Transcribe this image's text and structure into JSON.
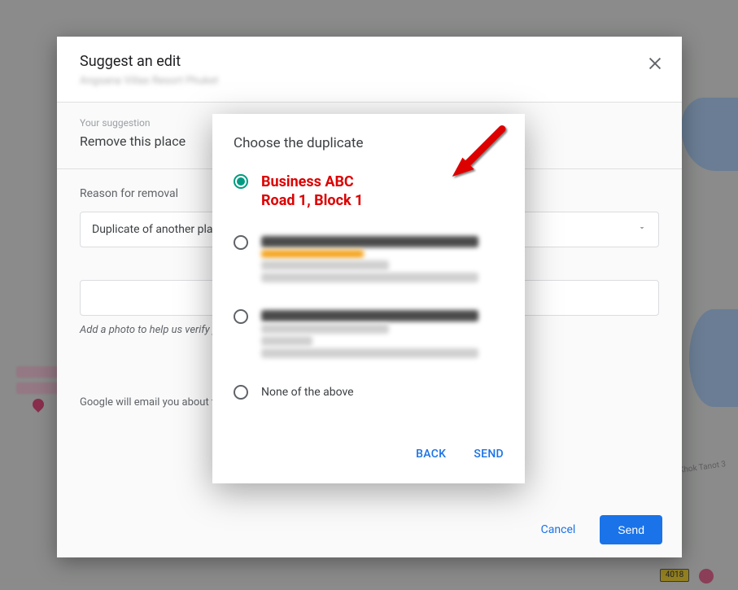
{
  "map": {
    "road_badge": "4018",
    "street_label": "Khok Tanot 3"
  },
  "panel": {
    "title": "Suggest an edit",
    "subtitle": "Angsana Villas Resort Phuket",
    "close_aria": "Close",
    "suggestion_label": "Your suggestion",
    "suggestion_value": "Remove this place",
    "reason_label": "Reason for removal",
    "reason_selected": "Duplicate of another place",
    "helper_text": "Add a photo to help us verify your suggestion — e.g. a photo showing the change or new name.",
    "disclaimer": "Google will email you about the status of your edits.",
    "cancel": "Cancel",
    "send": "Send"
  },
  "dialog": {
    "title": "Choose the duplicate",
    "options": [
      {
        "line1": "Business ABC",
        "line2": "Road 1, Block 1",
        "selected": true,
        "annotated": true
      },
      {
        "blurred": true,
        "selected": false
      },
      {
        "blurred": true,
        "selected": false
      },
      {
        "label": "None of the above",
        "selected": false
      }
    ],
    "back": "BACK",
    "send": "SEND"
  }
}
